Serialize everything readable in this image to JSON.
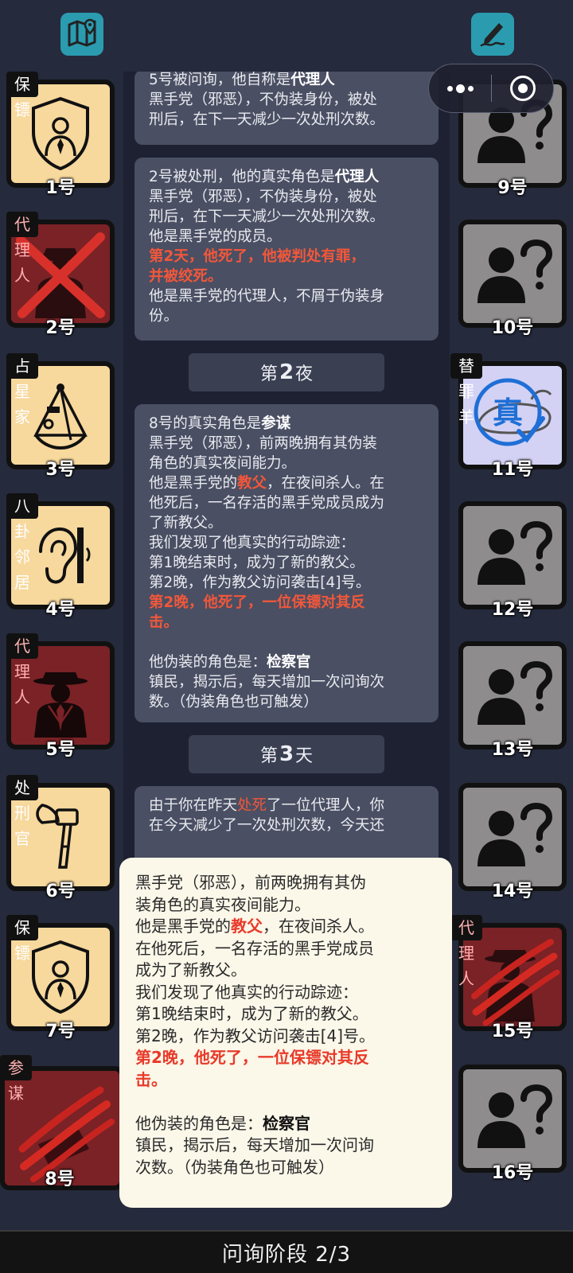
{
  "header": {
    "map_icon": "map-icon",
    "notes_icon": "pencil-note-icon"
  },
  "capsule": {
    "more_icon": "more-dots-icon",
    "close_icon": "target-close-icon"
  },
  "log": {
    "card1": {
      "line1_a": "5号被问询，他自称是",
      "line1_b": "代理人",
      "line2": "黑手党（邪恶），不伪装身份，被处",
      "line3": "刑后，在下一天减少一次处刑次数。"
    },
    "card2": {
      "line1_a": "2号被处刑，他的真实角色是",
      "line1_b": "代理人",
      "line2": "黑手党（邪恶），不伪装身份，被处",
      "line3": "刑后，在下一天减少一次处刑次数。",
      "line4": "他是黑手党的成员。",
      "line5": "第2天，他死了，他被判处有罪，",
      "line6": "并被绞死。",
      "line7": "他是黑手党的代理人，不屑于伪装身",
      "line8": "份。"
    },
    "night2": {
      "pre": "第",
      "num": "2",
      "post": "夜"
    },
    "card3": {
      "line1_a": "8号的真实角色是",
      "line1_b": "参谋",
      "line2": "黑手党（邪恶），前两晚拥有其伪装",
      "line3": "角色的真实夜间能力。",
      "line4_a": "他是黑手党的",
      "line4_b": "教父",
      "line4_c": "，在夜间杀人。在",
      "line5": "他死后，一名存活的黑手党成员成为",
      "line6": "了新教父。",
      "line7": "我们发现了他真实的行动踪迹：",
      "line8": "第1晚结束时，成为了新的教父。",
      "line9": "第2晚，作为教父访问袭击[4]号。",
      "line10": "第2晚，他死了，一位保镖对其反",
      "line11": "击。",
      "line12_a": "他伪装的角色是：",
      "line12_b": "检察官",
      "line13": "镇民，揭示后，每天增加一次问询次",
      "line14": "数。（伪装角色也可触发）"
    },
    "day3": {
      "pre": "第",
      "num": "3",
      "post": "天"
    },
    "card4": {
      "line1_a": "由于你在昨天",
      "line1_b": "处死",
      "line1_c": "了一位代理人，你",
      "line2": "在今天减少了一次处刑次数，今天还"
    }
  },
  "players": [
    {
      "number": "1号",
      "role": "保镖",
      "icon": "bodyguard-shield-icon"
    },
    {
      "number": "2号",
      "role": "代理人",
      "icon": "agent-executed-x-icon"
    },
    {
      "number": "3号",
      "role": "占星家",
      "icon": "sextant-icon"
    },
    {
      "number": "4号",
      "role": "八卦邻居",
      "icon": "ear-wall-icon"
    },
    {
      "number": "5号",
      "role": "代理人",
      "icon": "agent-fedora-icon"
    },
    {
      "number": "6号",
      "role": "处刑官",
      "icon": "axe-icon"
    },
    {
      "number": "7号",
      "role": "保镖",
      "icon": "bodyguard-shield-icon"
    },
    {
      "number": "8号",
      "role": "参谋",
      "icon": "claw-scratch-icon"
    },
    {
      "number": "9号",
      "role": "",
      "icon": "unknown-person-icon"
    },
    {
      "number": "10号",
      "role": "",
      "icon": "unknown-person-icon"
    },
    {
      "number": "11号",
      "role": "替罪羊",
      "icon": "scapegoat-truth-stamp-icon"
    },
    {
      "number": "12号",
      "role": "",
      "icon": "unknown-person-icon"
    },
    {
      "number": "13号",
      "role": "",
      "icon": "unknown-person-icon"
    },
    {
      "number": "14号",
      "role": "",
      "icon": "unknown-person-icon"
    },
    {
      "number": "15号",
      "role": "代理人",
      "icon": "agent-claw-scratch-icon"
    },
    {
      "number": "16号",
      "role": "",
      "icon": "unknown-person-icon"
    }
  ],
  "stamp_text": "真",
  "popup": {
    "line1": "黑手党（邪恶），前两晚拥有其伪",
    "line2": "装角色的真实夜间能力。",
    "line3_a": "他是黑手党的",
    "line3_b": "教父",
    "line3_c": "，在夜间杀人。",
    "line4": "在他死后，一名存活的黑手党成员",
    "line5": "成为了新教父。",
    "line6": "我们发现了他真实的行动踪迹：",
    "line7": "第1晚结束时，成为了新的教父。",
    "line8": "第2晚，作为教父访问袭击[4]号。",
    "line9": "第2晚，他死了，一位保镖对其反",
    "line10": "击。",
    "line11_a": "他伪装的角色是：",
    "line11_b": "检察官",
    "line12": "镇民，揭示后，每天增加一次问询",
    "line13": "次数。（伪装角色也可触发）"
  },
  "phase": {
    "label": "问询阶段 2/3"
  },
  "colors": {
    "accent_red": "#f2573a",
    "teal": "#2b9bb0",
    "cream": "#f7d89d",
    "maroon": "#7a2226"
  }
}
